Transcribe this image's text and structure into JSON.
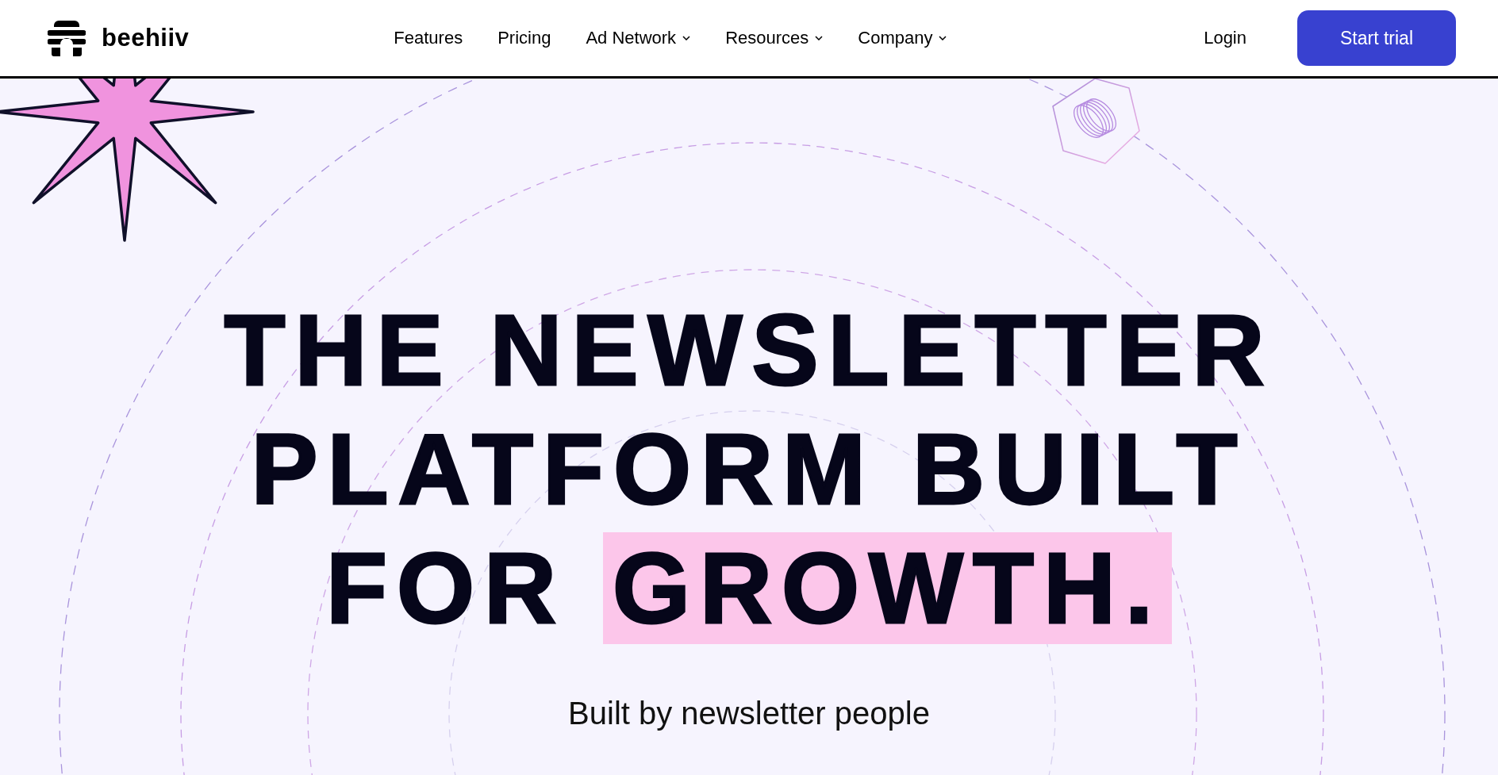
{
  "header": {
    "logo": {
      "text": "beehiiv"
    },
    "nav": [
      {
        "label": "Features",
        "has_dropdown": false
      },
      {
        "label": "Pricing",
        "has_dropdown": false
      },
      {
        "label": "Ad Network",
        "has_dropdown": true
      },
      {
        "label": "Resources",
        "has_dropdown": true
      },
      {
        "label": "Company",
        "has_dropdown": true
      }
    ],
    "login": "Login",
    "cta": "Start trial"
  },
  "hero": {
    "headline": [
      [
        {
          "text": "THE NEWSLETTER",
          "highlighted": false
        }
      ],
      [
        {
          "text": "PLATFORM BUILT",
          "highlighted": false
        }
      ],
      [
        {
          "text": "FOR ",
          "highlighted": false
        },
        {
          "text": "GROWTH.",
          "highlighted": true
        }
      ]
    ],
    "subtitle": "Built by newsletter people"
  }
}
